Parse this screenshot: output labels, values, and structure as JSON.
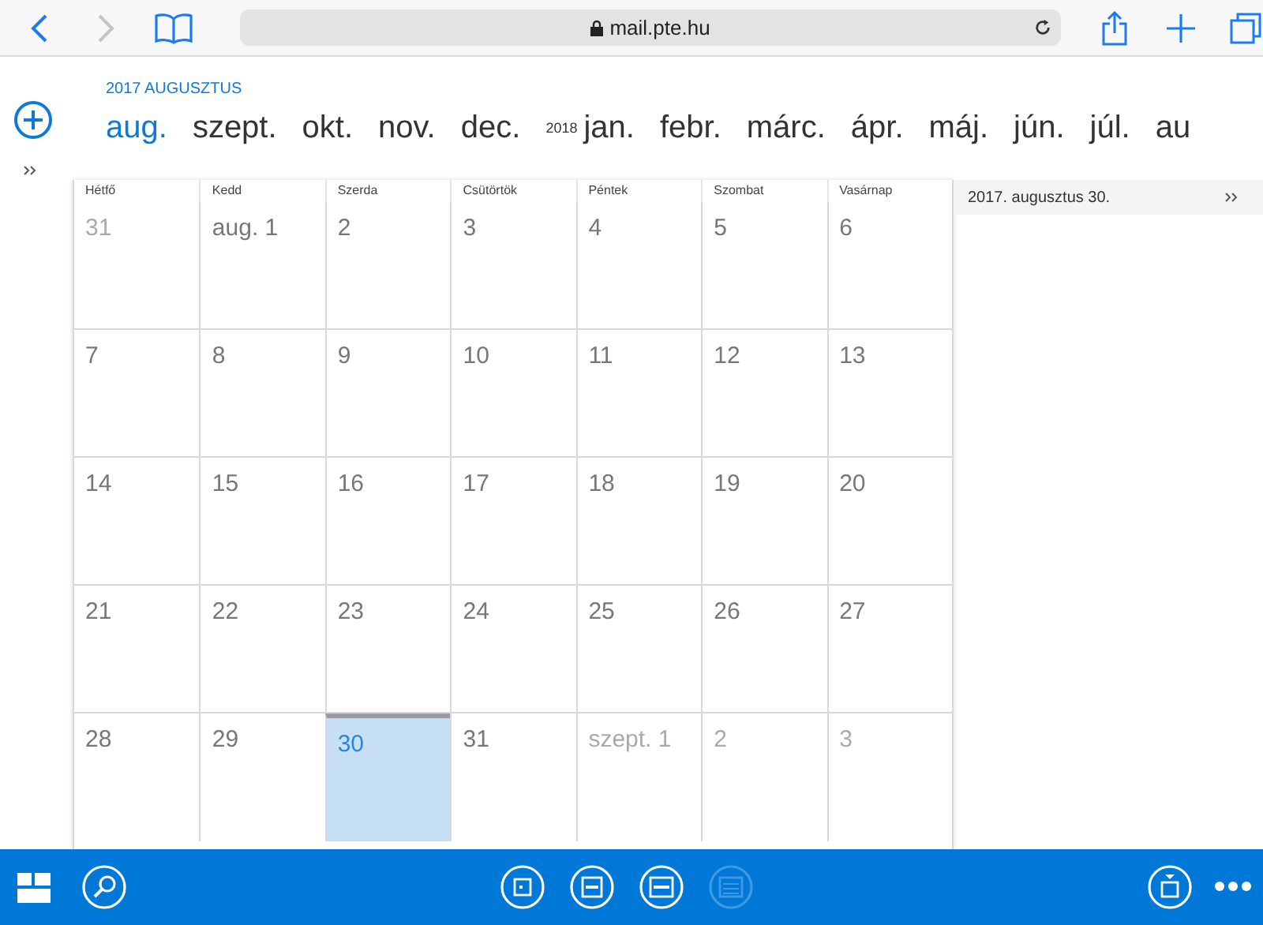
{
  "browser": {
    "url": "mail.pte.hu"
  },
  "calendar": {
    "heading": "2017 AUGUSZTUS",
    "months": [
      {
        "kind": "month",
        "label": "aug.",
        "selected": true
      },
      {
        "kind": "month",
        "label": "szept.",
        "selected": false
      },
      {
        "kind": "month",
        "label": "okt.",
        "selected": false
      },
      {
        "kind": "month",
        "label": "nov.",
        "selected": false
      },
      {
        "kind": "month",
        "label": "dec.",
        "selected": false
      },
      {
        "kind": "year",
        "label": "2018"
      },
      {
        "kind": "month",
        "label": "jan.",
        "selected": false
      },
      {
        "kind": "month",
        "label": "febr.",
        "selected": false
      },
      {
        "kind": "month",
        "label": "márc.",
        "selected": false
      },
      {
        "kind": "month",
        "label": "ápr.",
        "selected": false
      },
      {
        "kind": "month",
        "label": "máj.",
        "selected": false
      },
      {
        "kind": "month",
        "label": "jún.",
        "selected": false
      },
      {
        "kind": "month",
        "label": "júl.",
        "selected": false
      },
      {
        "kind": "month",
        "label": "au",
        "selected": false
      }
    ],
    "weekdays": [
      "Hétfő",
      "Kedd",
      "Szerda",
      "Csütörtök",
      "Péntek",
      "Szombat",
      "Vasárnap"
    ],
    "weeks": [
      [
        {
          "day": "31",
          "other_month": true,
          "selected": false
        },
        {
          "day": "aug. 1",
          "other_month": false,
          "selected": false
        },
        {
          "day": "2",
          "other_month": false,
          "selected": false
        },
        {
          "day": "3",
          "other_month": false,
          "selected": false
        },
        {
          "day": "4",
          "other_month": false,
          "selected": false
        },
        {
          "day": "5",
          "other_month": false,
          "selected": false
        },
        {
          "day": "6",
          "other_month": false,
          "selected": false
        }
      ],
      [
        {
          "day": "7",
          "other_month": false,
          "selected": false
        },
        {
          "day": "8",
          "other_month": false,
          "selected": false
        },
        {
          "day": "9",
          "other_month": false,
          "selected": false
        },
        {
          "day": "10",
          "other_month": false,
          "selected": false
        },
        {
          "day": "11",
          "other_month": false,
          "selected": false
        },
        {
          "day": "12",
          "other_month": false,
          "selected": false
        },
        {
          "day": "13",
          "other_month": false,
          "selected": false
        }
      ],
      [
        {
          "day": "14",
          "other_month": false,
          "selected": false
        },
        {
          "day": "15",
          "other_month": false,
          "selected": false
        },
        {
          "day": "16",
          "other_month": false,
          "selected": false
        },
        {
          "day": "17",
          "other_month": false,
          "selected": false
        },
        {
          "day": "18",
          "other_month": false,
          "selected": false
        },
        {
          "day": "19",
          "other_month": false,
          "selected": false
        },
        {
          "day": "20",
          "other_month": false,
          "selected": false
        }
      ],
      [
        {
          "day": "21",
          "other_month": false,
          "selected": false
        },
        {
          "day": "22",
          "other_month": false,
          "selected": false
        },
        {
          "day": "23",
          "other_month": false,
          "selected": false
        },
        {
          "day": "24",
          "other_month": false,
          "selected": false
        },
        {
          "day": "25",
          "other_month": false,
          "selected": false
        },
        {
          "day": "26",
          "other_month": false,
          "selected": false
        },
        {
          "day": "27",
          "other_month": false,
          "selected": false
        }
      ],
      [
        {
          "day": "28",
          "other_month": false,
          "selected": false
        },
        {
          "day": "29",
          "other_month": false,
          "selected": false
        },
        {
          "day": "30",
          "other_month": false,
          "selected": true
        },
        {
          "day": "31",
          "other_month": false,
          "selected": false
        },
        {
          "day": "szept. 1",
          "other_month": true,
          "selected": false
        },
        {
          "day": "2",
          "other_month": true,
          "selected": false
        },
        {
          "day": "3",
          "other_month": true,
          "selected": false
        }
      ]
    ]
  },
  "agenda": {
    "date": "2017. augusztus 30."
  },
  "toolbar": {
    "views": [
      {
        "kind": "day",
        "disabled": false
      },
      {
        "kind": "workweek",
        "disabled": false
      },
      {
        "kind": "week",
        "disabled": false
      },
      {
        "kind": "month",
        "disabled": true
      }
    ]
  }
}
